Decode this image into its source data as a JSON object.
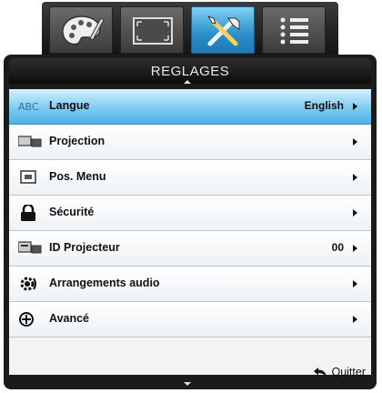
{
  "tabs": [
    {
      "icon": "palette-icon",
      "active": false
    },
    {
      "icon": "screen-frame-icon",
      "active": false
    },
    {
      "icon": "tools-icon",
      "active": true
    },
    {
      "icon": "list-icon",
      "active": false
    }
  ],
  "header": {
    "title": "REGLAGES"
  },
  "menu": {
    "items": [
      {
        "label": "Langue",
        "value": "English",
        "icon": "language-icon",
        "selected": true
      },
      {
        "label": "Projection",
        "value": "",
        "icon": "projection-icon",
        "selected": false
      },
      {
        "label": "Pos. Menu",
        "value": "",
        "icon": "menu-position-icon",
        "selected": false
      },
      {
        "label": "Sécurité",
        "value": "",
        "icon": "lock-icon",
        "selected": false
      },
      {
        "label": "ID Projecteur",
        "value": "00",
        "icon": "projector-id-icon",
        "selected": false
      },
      {
        "label": "Arrangements audio",
        "value": "",
        "icon": "audio-settings-icon",
        "selected": false
      },
      {
        "label": "Avancé",
        "value": "",
        "icon": "advanced-icon",
        "selected": false
      }
    ]
  },
  "footer": {
    "quit_label": "Quitter",
    "quit_icon": "return-arrow-icon"
  },
  "colors": {
    "accent": "#4cb2e8",
    "panel": "#1b1b1b",
    "row": "#f3f3f3"
  }
}
